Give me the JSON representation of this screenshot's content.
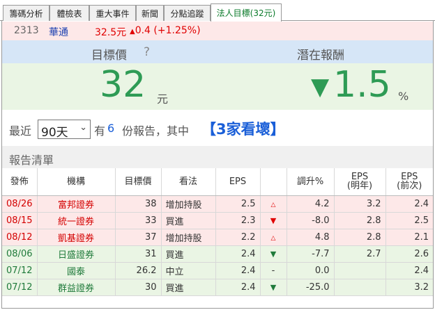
{
  "tabs": [
    {
      "label": "籌碼分析",
      "active": false
    },
    {
      "label": "體檢表",
      "active": false
    },
    {
      "label": "重大事件",
      "active": false
    },
    {
      "label": "新聞",
      "active": false
    },
    {
      "label": "分點追蹤",
      "active": false
    },
    {
      "label": "法人目標(32元)",
      "active": true
    }
  ],
  "stock": {
    "code": "2313",
    "name": "華通",
    "price": "32.5元",
    "change_arrow": "▲",
    "change": "0.4 (+1.25%)"
  },
  "header": {
    "target_label": "目標價",
    "help_icon": "?",
    "return_label": "潛在報酬"
  },
  "summary": {
    "target_value": "32",
    "target_unit": "元",
    "return_arrow": "▼",
    "return_value": "1.5",
    "return_unit": "%"
  },
  "filter": {
    "prefix": "最近",
    "period": "90天",
    "have": "有",
    "count": "6",
    "suffix": "份報告，其中",
    "verdict": "【3家看壞】"
  },
  "list_title": "報告清單",
  "table": {
    "headers": [
      "發佈",
      "機構",
      "目標價",
      "看法",
      "EPS",
      "",
      "調升%",
      "EPS\n(明年)",
      "EPS\n(前次)"
    ],
    "rows": [
      {
        "trend": "up",
        "date": "08/26",
        "broker": "富邦證券",
        "target": "38",
        "view": "增加持股",
        "eps": "2.5",
        "arrow": "△",
        "arrow_style": "arr-up-hollow",
        "change": "4.2",
        "eps_next": "3.2",
        "eps_prev": "2.4"
      },
      {
        "trend": "up",
        "date": "08/15",
        "broker": "統一證券",
        "target": "33",
        "view": "買進",
        "eps": "2.3",
        "arrow": "▼",
        "arrow_style": "arr-down-red",
        "change": "-8.0",
        "eps_next": "2.8",
        "eps_prev": "2.5"
      },
      {
        "trend": "up",
        "date": "08/12",
        "broker": "凱基證券",
        "target": "37",
        "view": "增加持股",
        "eps": "2.2",
        "arrow": "△",
        "arrow_style": "arr-up-hollow",
        "change": "4.8",
        "eps_next": "2.8",
        "eps_prev": "2.1"
      },
      {
        "trend": "down",
        "date": "08/06",
        "broker": "日盛證券",
        "target": "31",
        "view": "買進",
        "eps": "2.4",
        "arrow": "▼",
        "arrow_style": "arr-down-green",
        "change": "-7.7",
        "eps_next": "2.7",
        "eps_prev": "2.6"
      },
      {
        "trend": "flat",
        "date": "07/12",
        "broker": "國泰",
        "target": "26.2",
        "view": "中立",
        "eps": "2.4",
        "arrow": "-",
        "arrow_style": "",
        "change": "0.0",
        "eps_next": "",
        "eps_prev": "2.4"
      },
      {
        "trend": "down",
        "date": "07/12",
        "broker": "群益證券",
        "target": "30",
        "view": "買進",
        "eps": "2.4",
        "arrow": "▼",
        "arrow_style": "arr-down-green",
        "change": "-25.0",
        "eps_next": "",
        "eps_prev": "3.2"
      }
    ]
  },
  "colors": {
    "up_red": "#e00000",
    "down_green": "#1f7a3a",
    "accent_blue": "#1a5fd8",
    "big_green": "#2e9b55"
  }
}
